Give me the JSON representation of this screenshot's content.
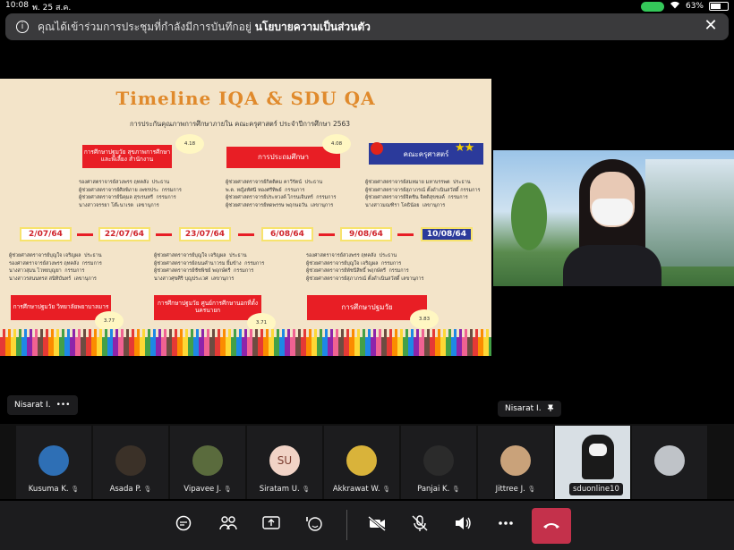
{
  "status_bar": {
    "time": "10:08",
    "date": "พ. 25 ส.ค.",
    "battery": "63%",
    "battery_level": 0.63
  },
  "banner": {
    "text": "คุณได้เข้าร่วมการประชุมที่กำลังมีการบันทึกอยู่",
    "link": "นโยบายความเป็นส่วนตัว",
    "close": "✕"
  },
  "slide": {
    "title": "Timeline IQA & SDU QA",
    "subtitle": "การประกันคุณภาพการศึกษาภายใน คณะครุศาสตร์ ประจำปีการศึกษา 2563",
    "top_boxes": [
      {
        "label": "การศึกษาปฐมวัย สุขภาพการศึกษาและพี่เลี้ยง สำนักงาน",
        "score": "4.18"
      },
      {
        "label": "การประถมศึกษา",
        "score": "4.08"
      },
      {
        "label": "คณะครุศาสตร์",
        "stars": "★★"
      }
    ],
    "top_names": [
      "รองศาสตราจารย์สวงพรร ฤทคลัง  ประธาน\nผู้ช่วยศาสตราจารย์ศิลพิภาย เพชรประ  กรรมการ\nผู้ช่วยศาสตราจารย์นิคุมล สุรเรนทรี  กรรมการ\nนางสาวจรรยา โต๊ะนาเรต  เลขานุการ",
      "ผู้ช่วยศาสตราจารย์กิตติคม คาวีรัตน์  ประธาน\nพ.ต. หญิงทัศนี ทองศรีทิพย์  กรรมการ\nผู้ช่วยศาสตราจารย์ประหวงค์ ไกรนเจินทร์  กรรมการ\nผู้ช่วยศาสตราจารย์ทดพรรษ พฤกษอวัน  เลขานุการ",
      "ผู้ช่วยศาสตราจารย์สมหมาย มหาบรรพต  ประธาน\nผู้ช่วยศาสตราจารย์สุภาภรณ์ ตั้งดำเนินสวัสดิ์ กรรมการ\nผู้ช่วยศาสตราจารย์จิตชิน จิตติสุขชงค์  กรรมการ\nนางสาวมณฑิรา โคธิน้อย  เลขานุการ"
    ],
    "dates": [
      "2/07/64",
      "22/07/64",
      "23/07/64",
      "6/08/64",
      "9/08/64",
      "10/08/64"
    ],
    "bottom_names": [
      "ผู้ช่วยศาสตราจารย์บุญใจ เจริญผล  ประธาน\nรองศาสตราจารย์สวงพรร ฤทคลัง  กรรมการ\nนางสาวสุมน ไวทยบุญยา  กรรมการ\nนางสาวรสนนทรส สนิทิบันทร์  เลขานุการ",
      "ผู้ช่วยศาสตราจารย์บุญใจ เจริญผล  ประธาน\nผู้ช่วยศาสตราจารย์ถนนคำนาวรม ยิ้มข้าง  กรรมการ\nผู้ช่วยศาสตราจารย์ชัชพิชย์ พฤกษ์ตรี  กรรมการ\nนางสาวศุขศิริ บุญประเวศ  เลขานุการ",
      "รองศาสตราจารย์สวงพรร ฤทคลัง  ประธาน\nผู้ช่วยศาสตราจารย์บุญใจ เจริญผล  กรรมการ\nผู้ช่วยศาสตราจารย์พัชนีสิทธิ์ พฤกษ์ตรี  กรรมการ\nผู้ช่วยศาสตราจารย์สุภาภรณ์ ตั้งดำเนินสวัสดิ์ เลขานุการ"
    ],
    "bottom_boxes": [
      {
        "label": "การศึกษาปฐมวัย วิทยาลัยพยาบาลมาร",
        "score": "3.77"
      },
      {
        "label": "การศึกษาปฐมวัย ศูนย์การศึกษานอกที่ตั้ง นครนายก",
        "score": "3.71"
      },
      {
        "label": "การศึกษาปฐมวัย",
        "score": "3.83"
      }
    ]
  },
  "presenter_tag": {
    "name": "Nisarat I.",
    "more": "•••"
  },
  "video_tag": {
    "name": "Nisarat I."
  },
  "participants": [
    {
      "name": "Kusuma K."
    },
    {
      "name": "Asada P."
    },
    {
      "name": "Vipavee J."
    },
    {
      "name": "Siratam U.",
      "initials": "SU"
    },
    {
      "name": "Akkrawat W."
    },
    {
      "name": "Panjai K."
    },
    {
      "name": "Jittree J."
    },
    {
      "name": "sduonline10"
    },
    {
      "name": ""
    }
  ],
  "controls": {
    "chat": "chat-icon",
    "people": "people-icon",
    "share": "share-icon",
    "react": "reactions-icon",
    "camera": "camera-off-icon",
    "mic": "mic-off-icon",
    "speaker": "speaker-icon",
    "more": "more-icon",
    "leave": "hangup-icon"
  }
}
